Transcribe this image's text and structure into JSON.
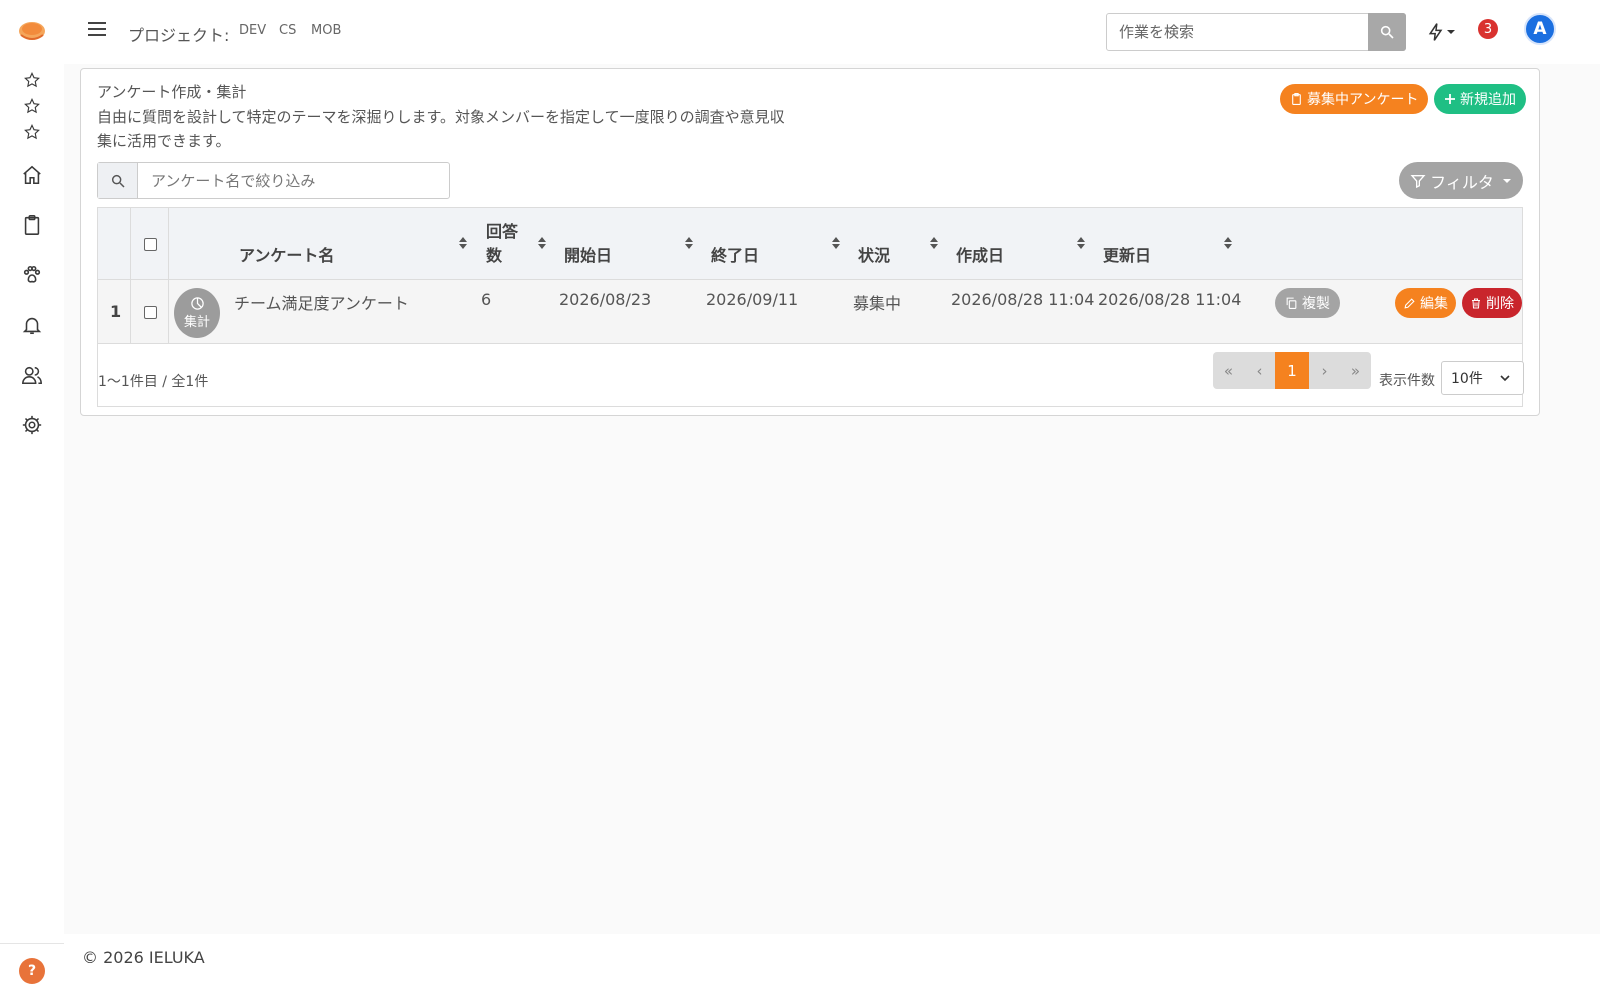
{
  "topbar": {
    "project_label": "プロジェクト:",
    "projects": [
      "DEV",
      "CS",
      "MOB"
    ],
    "search_placeholder": "作業を検索",
    "notification_count": "3",
    "avatar_initial": "A"
  },
  "card": {
    "title": "アンケート作成・集計",
    "description": "自由に質問を設計して特定のテーマを深掘りします。対象メンバーを指定して一度限りの調査や意見収集に活用できます。",
    "active_surveys_button": "募集中アンケート",
    "add_button": "新規追加",
    "filter_placeholder": "アンケート名で絞り込み",
    "filter_button": "フィルタ"
  },
  "table": {
    "headers": {
      "name": "アンケート名",
      "answers_line1": "回答",
      "answers_line2": "数",
      "start": "開始日",
      "end": "終了日",
      "status": "状況",
      "created": "作成日",
      "updated": "更新日"
    },
    "rows": [
      {
        "index": "1",
        "aggregate_label": "集計",
        "name": "チーム満足度アンケート",
        "answers": "6",
        "start": "2026/08/23",
        "end": "2026/09/11",
        "status": "募集中",
        "created": "2026/08/28 11:04",
        "updated": "2026/08/28 11:04",
        "copy_label": "複製",
        "edit_label": "編集",
        "delete_label": "削除"
      }
    ]
  },
  "pagination": {
    "info": "1〜1件目 / 全1件",
    "first": "«",
    "prev": "‹",
    "current": "1",
    "next": "›",
    "last": "»",
    "per_page_label": "表示件数",
    "per_page_value": "10件"
  },
  "footer": {
    "copyright": "© 2026 IELUKA",
    "help": "?"
  },
  "colors": {
    "accent_orange": "#f5821f",
    "accent_green": "#1fbf84",
    "danger_red": "#c9252c",
    "avatar_blue": "#1b6fe0"
  }
}
